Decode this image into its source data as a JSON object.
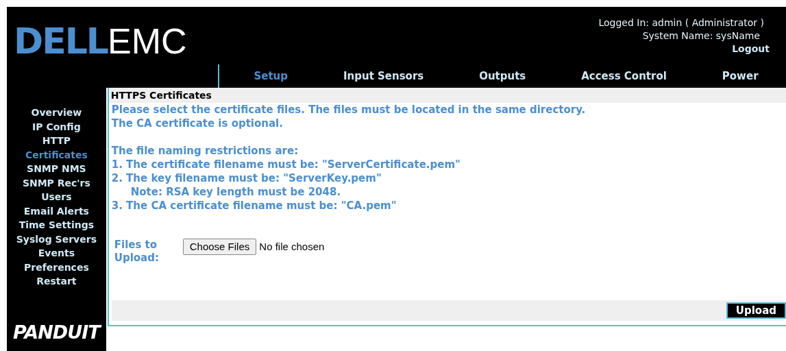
{
  "header": {
    "logo_primary": "DELL",
    "logo_secondary": "EMC",
    "logged_in": "Logged In: admin ( Administrator )",
    "system_name": "System Name: sysName",
    "logout": "Logout"
  },
  "tabs": [
    {
      "label": "Setup",
      "selected": true
    },
    {
      "label": "Input Sensors",
      "selected": false
    },
    {
      "label": "Outputs",
      "selected": false
    },
    {
      "label": "Access Control",
      "selected": false
    },
    {
      "label": "Power",
      "selected": false
    }
  ],
  "sidebar": {
    "items": [
      {
        "label": "Overview",
        "selected": false
      },
      {
        "label": "IP Config",
        "selected": false
      },
      {
        "label": "HTTP",
        "selected": false
      },
      {
        "label": "Certificates",
        "selected": true
      },
      {
        "label": "SNMP NMS",
        "selected": false
      },
      {
        "label": "SNMP Rec'rs",
        "selected": false
      },
      {
        "label": "Users",
        "selected": false
      },
      {
        "label": "Email Alerts",
        "selected": false
      },
      {
        "label": "Time Settings",
        "selected": false
      },
      {
        "label": "Syslog Servers",
        "selected": false
      },
      {
        "label": "Events",
        "selected": false
      },
      {
        "label": "Preferences",
        "selected": false
      },
      {
        "label": "Restart",
        "selected": false
      }
    ],
    "brand": "PANDUIT"
  },
  "panel": {
    "title": "HTTPS Certificates",
    "intro": [
      "Please select the certificate files. The files must be located in the same directory.",
      "The CA certificate is optional."
    ],
    "rules": [
      {
        "text": "The file naming restrictions are:",
        "indent": false
      },
      {
        "text": "1. The certificate filename must be: \"ServerCertificate.pem\"",
        "indent": false
      },
      {
        "text": "2. The key filename must be: \"ServerKey.pem\"",
        "indent": false
      },
      {
        "text": "Note: RSA key length must be 2048.",
        "indent": true
      },
      {
        "text": "3. The CA certificate filename must be: \"CA.pem\"",
        "indent": false
      }
    ],
    "upload_label": "Files to Upload:",
    "choose_button": "Choose Files",
    "file_status": "No file chosen",
    "upload_button": "Upload"
  }
}
